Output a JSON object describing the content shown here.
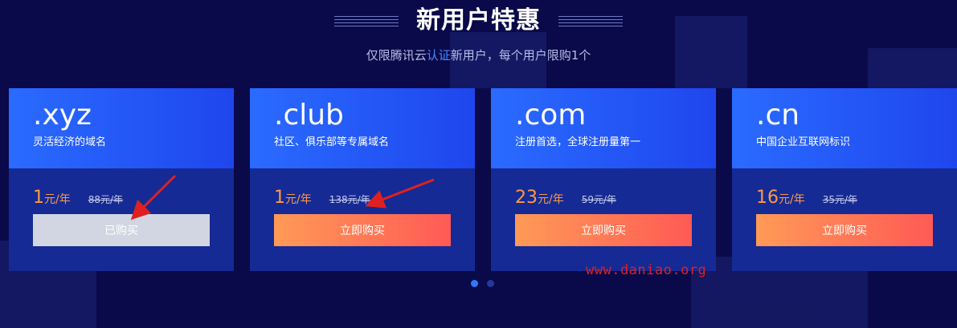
{
  "header": {
    "title": "新用户特惠",
    "subtitle_prefix": "仅限腾讯云",
    "subtitle_link": "认证",
    "subtitle_suffix": "新用户，每个用户限购1个"
  },
  "cards": [
    {
      "tld": ".xyz",
      "desc": "灵活经济的域名",
      "price": "1",
      "unit": "元/年",
      "original": "88元/年",
      "button": "已购买",
      "purchased": true
    },
    {
      "tld": ".club",
      "desc": "社区、俱乐部等专属域名",
      "price": "1",
      "unit": "元/年",
      "original": "138元/年",
      "button": "立即购买",
      "purchased": false
    },
    {
      "tld": ".com",
      "desc": "注册首选，全球注册量第一",
      "price": "23",
      "unit": "元/年",
      "original": "59元/年",
      "button": "立即购买",
      "purchased": false
    },
    {
      "tld": ".cn",
      "desc": "中国企业互联网标识",
      "price": "16",
      "unit": "元/年",
      "original": "35元/年",
      "button": "立即购买",
      "purchased": false
    }
  ],
  "carousel": {
    "page_count": 2,
    "active_index": 0
  },
  "watermark": "www.daniao.org",
  "colors": {
    "background": "#0a0a4a",
    "card_top": "#2a6bff",
    "card_body": "#152a94",
    "price": "#ff9a42",
    "button_gradient_start": "#ff9a56",
    "button_gradient_end": "#ff5a55",
    "button_disabled": "#d2d6e2",
    "annotation": "#e02020"
  }
}
